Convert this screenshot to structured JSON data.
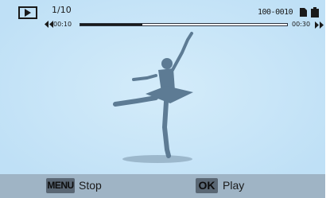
{
  "status_bar": {
    "mode_icon": "play-icon",
    "counter": "1/10",
    "file_number": "100-0010",
    "card_icon": "memory-card-icon",
    "battery_icon": "battery-icon"
  },
  "video": {
    "time_start": "00:10",
    "time_end": "00:30",
    "progress": 0.3,
    "rewind_icon": "rewind-icon",
    "forward_icon": "fast-forward-icon"
  },
  "photo": {
    "subject": "ballerina-silhouette"
  },
  "bottom_bar": {
    "menu_key": "MENU",
    "menu_action": "Stop",
    "ok_key": "OK",
    "ok_action": "Play"
  },
  "colors": {
    "screen_bg": "#bfe0f6",
    "bottom_bar": "#9fb4c5",
    "key_bg": "#5a6774",
    "silhouette": "#5d7b94"
  }
}
